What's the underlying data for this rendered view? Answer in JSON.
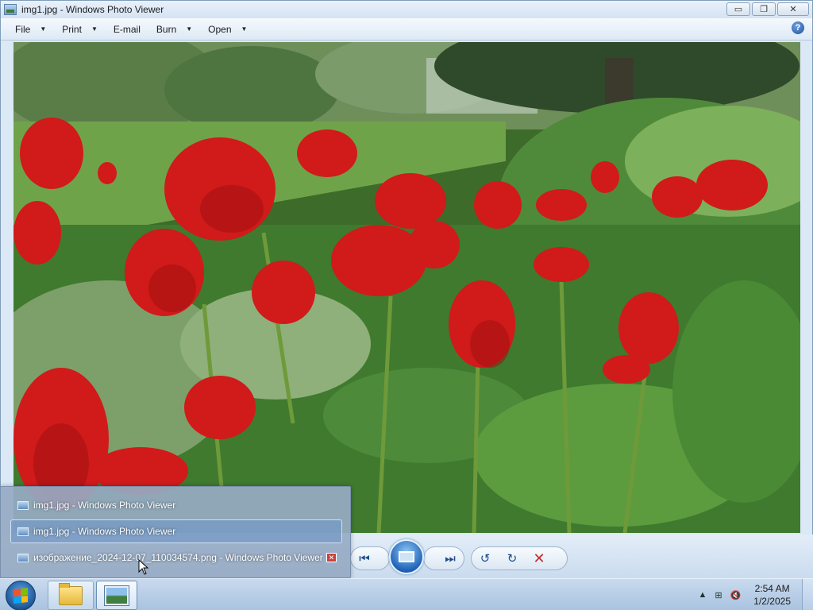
{
  "window": {
    "title": "img1.jpg - Windows Photo Viewer",
    "controls": {
      "minimize": "▭",
      "maximize": "❐",
      "close": "✕"
    }
  },
  "menu": {
    "items": [
      {
        "label": "File",
        "has_dropdown": true
      },
      {
        "label": "Print",
        "has_dropdown": true
      },
      {
        "label": "E-mail",
        "has_dropdown": false
      },
      {
        "label": "Burn",
        "has_dropdown": true
      },
      {
        "label": "Open",
        "has_dropdown": true
      }
    ],
    "help": "?"
  },
  "photo": {
    "subject": "red tulips in a garden"
  },
  "playback": {
    "prev": "⏮",
    "next": "⏭",
    "rotate_ccw": "↺",
    "rotate_cw": "↻",
    "delete": "✕"
  },
  "taskbar_popup": {
    "items": [
      {
        "label": "img1.jpg - Windows Photo Viewer",
        "highlighted": false,
        "has_close": false
      },
      {
        "label": "img1.jpg - Windows Photo Viewer",
        "highlighted": true,
        "has_close": false
      },
      {
        "label": "изображение_2024-12-07_110034574.png - Windows Photo Viewer",
        "highlighted": false,
        "has_close": true
      }
    ],
    "close_glyph": "✕"
  },
  "taskbar": {
    "tray_icons": [
      "▲",
      "⊞",
      "🔇"
    ],
    "time": "2:54 AM",
    "date": "1/2/2025"
  }
}
